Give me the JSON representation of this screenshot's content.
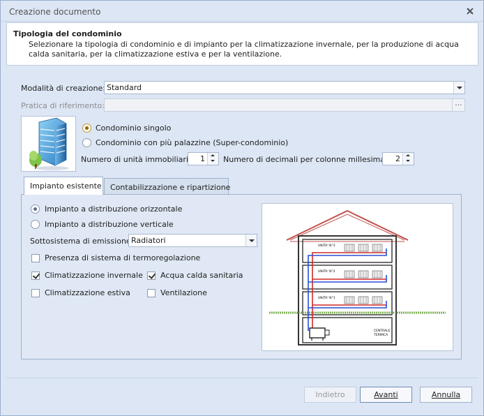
{
  "window": {
    "title": "Creazione documento"
  },
  "header": {
    "title": "Tipologia del condominio",
    "description": "Selezionare la tipologia di condominio e di impianto per la climatizzazione invernale, per la produzione di acqua calda sanitaria, per la climatizzazione estiva e per la ventilazione."
  },
  "form": {
    "modalita_label": "Modalità di creazione:",
    "modalita_value": "Standard",
    "pratica_label": "Pratica di riferimento:",
    "pratica_value": "",
    "pratica_button": "...",
    "radio_singolo": "Condominio singolo",
    "radio_super": "Condominio con più palazzine (Super-condominio)",
    "unita_label": "Numero di unità immobiliari:",
    "unita_value": "1",
    "decimali_label": "Numero di decimali per colonne millesimali:",
    "decimali_value": "2"
  },
  "tabs": [
    {
      "label": "Impianto esistente"
    },
    {
      "label": "Contabilizzazione e ripartizione"
    }
  ],
  "impianto": {
    "radio_orizzontale": "Impianto a distribuzione orizzontale",
    "radio_verticale": "Impianto a distribuzione verticale",
    "sottosistema_label": "Sottosistema di emissione:",
    "sottosistema_value": "Radiatori",
    "check_termoregolazione": "Presenza di sistema di termoregolazione",
    "check_climatizzazione_invernale": "Climatizzazione invernale",
    "check_acqua_calda": "Acqua calda sanitaria",
    "check_climatizzazione_estiva": "Climatizzazione estiva",
    "check_ventilazione": "Ventilazione"
  },
  "diagram": {
    "unit3": "UNITA' N°3",
    "unit2": "UNITA' N°2",
    "unit1": "UNITA' N°1",
    "centrale_1": "CENTRALE",
    "centrale_2": "TERMICA"
  },
  "buttons": {
    "indietro": "Indietro",
    "avanti": "Avanti",
    "annulla": "Annulla"
  }
}
